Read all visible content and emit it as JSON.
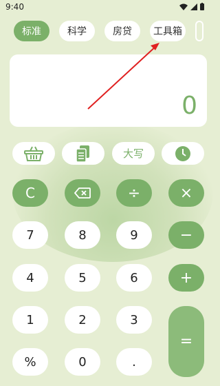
{
  "status": {
    "time": "9:40"
  },
  "tabs": [
    "标准",
    "科学",
    "房贷",
    "工具箱"
  ],
  "display": {
    "value": "0"
  },
  "tools": {
    "uppercase_label": "大写"
  },
  "keys": {
    "clear": "C",
    "divide": "÷",
    "multiply": "×",
    "seven": "7",
    "eight": "8",
    "nine": "9",
    "minus": "−",
    "four": "4",
    "five": "5",
    "six": "6",
    "plus": "+",
    "one": "1",
    "two": "2",
    "three": "3",
    "equals": "=",
    "percent": "%",
    "zero": "0",
    "dot": "."
  },
  "colors": {
    "accent": "#7bb069",
    "background": "#e6eed3",
    "annotation": "#e02020"
  }
}
